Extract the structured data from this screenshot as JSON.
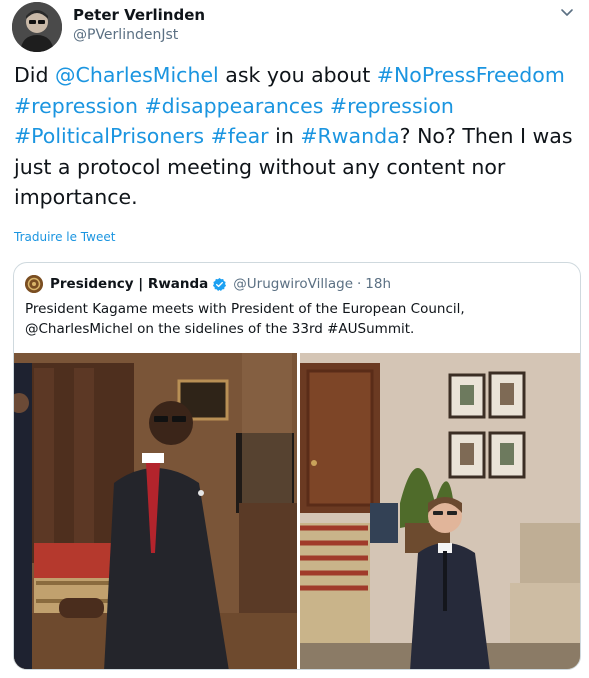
{
  "tweet": {
    "author": {
      "display_name": "Peter Verlinden",
      "handle": "@PVerlindenJst"
    },
    "text_parts": [
      {
        "t": "Did ",
        "link": false
      },
      {
        "t": "@CharlesMichel",
        "link": true
      },
      {
        "t": " ask you about ",
        "link": false
      },
      {
        "t": "#NoPressFreedom",
        "link": true
      },
      {
        "t": " ",
        "link": false
      },
      {
        "t": "#repression",
        "link": true
      },
      {
        "t": " ",
        "link": false
      },
      {
        "t": "#disappearances",
        "link": true
      },
      {
        "t": " ",
        "link": false
      },
      {
        "t": "#repression",
        "link": true
      },
      {
        "t": " ",
        "link": false
      },
      {
        "t": "#PoliticalPrisoners",
        "link": true
      },
      {
        "t": " ",
        "link": false
      },
      {
        "t": "#fear",
        "link": true
      },
      {
        "t": " in ",
        "link": false
      },
      {
        "t": "#Rwanda",
        "link": true
      },
      {
        "t": "? No? Then I was just a protocol meeting without any content nor importance.",
        "link": false
      }
    ],
    "translate_label": "Traduire le Tweet"
  },
  "quoted": {
    "display_name": "Presidency | Rwanda",
    "handle": "@UrugwiroVillage",
    "separator": "·",
    "time": "18h",
    "text_line1": "President Kagame meets with President of the European Council,",
    "text_line2": "@CharlesMichel on the sidelines of the 33rd #AUSummit."
  },
  "colors": {
    "link": "#1b95e0",
    "secondary_text": "#5b7083",
    "verified": "#1da1f2",
    "border": "#cfd9de"
  },
  "icons": [
    "chevron-down-icon",
    "verified-badge-icon"
  ]
}
